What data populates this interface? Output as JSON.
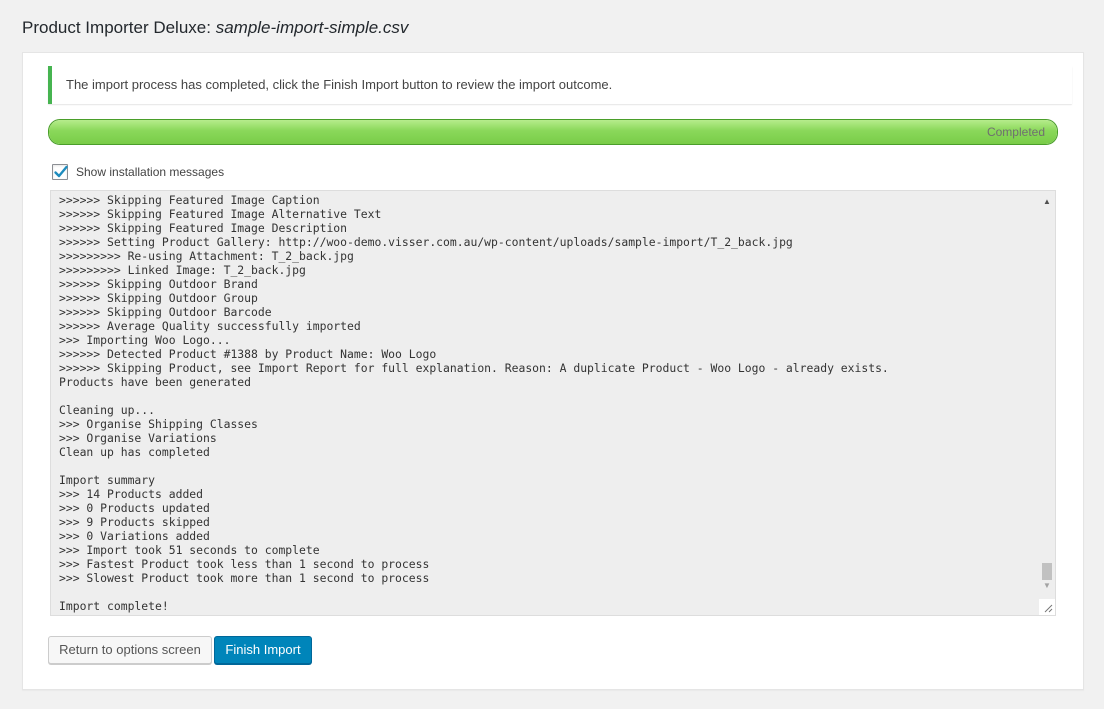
{
  "header": {
    "title_prefix": "Product Importer Deluxe:",
    "title_filename": "sample-import-simple.csv"
  },
  "notice": {
    "text": "The import process has completed, click the Finish Import button to review the import outcome.",
    "color": "#46b450"
  },
  "progress": {
    "label": "Completed",
    "fraction": 1.0
  },
  "show_messages": {
    "label": "Show installation messages",
    "checked": true
  },
  "log": {
    "lines": [
      ">>>>>> Skipping Featured Image Caption",
      ">>>>>> Skipping Featured Image Alternative Text",
      ">>>>>> Skipping Featured Image Description",
      ">>>>>> Setting Product Gallery: http://woo-demo.visser.com.au/wp-content/uploads/sample-import/T_2_back.jpg",
      ">>>>>>>>> Re-using Attachment: T_2_back.jpg",
      ">>>>>>>>> Linked Image: T_2_back.jpg",
      ">>>>>> Skipping Outdoor Brand",
      ">>>>>> Skipping Outdoor Group",
      ">>>>>> Skipping Outdoor Barcode",
      ">>>>>> Average Quality successfully imported",
      ">>> Importing Woo Logo...",
      ">>>>>> Detected Product #1388 by Product Name: Woo Logo",
      ">>>>>> Skipping Product, see Import Report for full explanation. Reason: A duplicate Product - Woo Logo - already exists.",
      "Products have been generated",
      "",
      "Cleaning up...",
      ">>> Organise Shipping Classes",
      ">>> Organise Variations",
      "Clean up has completed",
      "",
      "Import summary",
      ">>> 14 Products added",
      ">>> 0 Products updated",
      ">>> 9 Products skipped",
      ">>> 0 Variations added",
      ">>> Import took 51 seconds to complete",
      ">>> Fastest Product took less than 1 second to process",
      ">>> Slowest Product took more than 1 second to process",
      "",
      "Import complete!"
    ]
  },
  "buttons": {
    "return_label": "Return to options screen",
    "finish_label": "Finish Import"
  },
  "icons": {
    "checkbox_check": "checkmark-icon",
    "scroll_up": "arrow-up-icon",
    "scroll_down": "arrow-down-icon",
    "resize": "resize-grip-icon"
  },
  "colors": {
    "primary_button": "#0085ba",
    "progress_green": "#8ad85a",
    "checkmark": "#1e8cbe"
  }
}
